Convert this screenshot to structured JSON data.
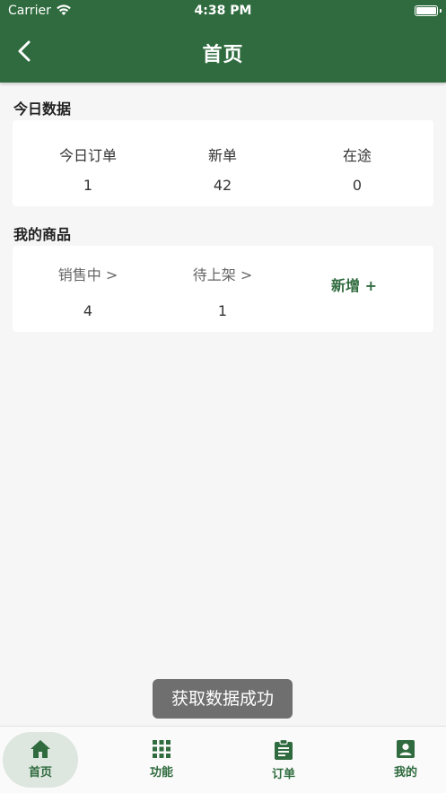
{
  "status_bar": {
    "carrier": "Carrier",
    "time": "4:38 PM"
  },
  "nav": {
    "title": "首页",
    "back_icon": "chevron-left-icon"
  },
  "today": {
    "title": "今日数据",
    "stats": [
      {
        "label": "今日订单",
        "value": "1"
      },
      {
        "label": "新单",
        "value": "42"
      },
      {
        "label": "在途",
        "value": "0"
      }
    ]
  },
  "products": {
    "title": "我的商品",
    "stats": [
      {
        "label": "销售中 >",
        "value": "4"
      },
      {
        "label": "待上架 >",
        "value": "1"
      }
    ],
    "add_label": "新增 +"
  },
  "toast": "获取数据成功",
  "tabs": [
    {
      "label": "首页",
      "icon": "home-icon",
      "active": true
    },
    {
      "label": "功能",
      "icon": "grid-icon",
      "active": false
    },
    {
      "label": "订单",
      "icon": "clipboard-icon",
      "active": false
    },
    {
      "label": "我的",
      "icon": "account-box-icon",
      "active": false
    }
  ],
  "colors": {
    "primary": "#2f6b3e",
    "background": "#f6f6f6",
    "toast": "#6f6f6f"
  }
}
